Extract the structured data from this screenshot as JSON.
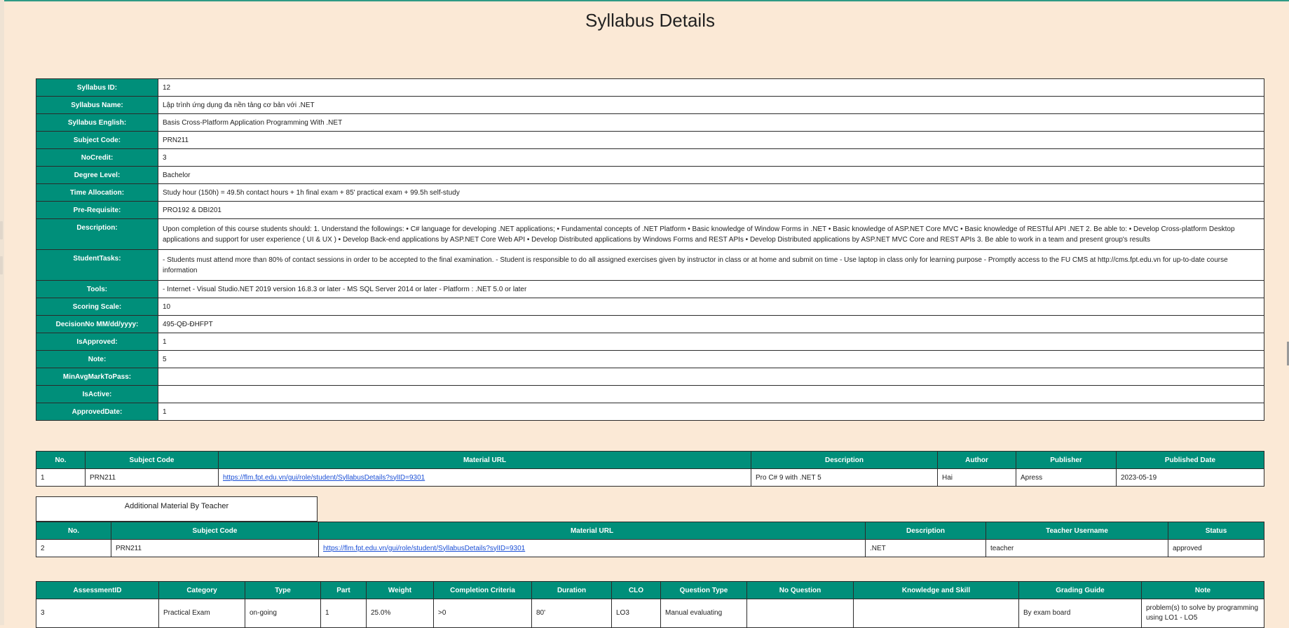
{
  "page": {
    "title": "Syllabus Details"
  },
  "details": {
    "rows": [
      {
        "label": "Syllabus ID:",
        "value": "12"
      },
      {
        "label": "Syllabus Name:",
        "value": "Lập trình ứng dụng đa nền tảng cơ bản với .NET"
      },
      {
        "label": "Syllabus English:",
        "value": "Basis Cross-Platform Application Programming With .NET"
      },
      {
        "label": "Subject Code:",
        "value": "PRN211"
      },
      {
        "label": "NoCredit:",
        "value": "3"
      },
      {
        "label": "Degree Level:",
        "value": "Bachelor"
      },
      {
        "label": "Time Allocation:",
        "value": "Study hour (150h) = 49.5h contact hours + 1h final exam + 85' practical exam + 99.5h self-study"
      },
      {
        "label": "Pre-Requisite:",
        "value": "PRO192 & DBI201"
      },
      {
        "label": "Description:",
        "value": "Upon completion of this course students should: 1. Understand the followings: • C# language for developing .NET applications; • Fundamental concepts of .NET Platform • Basic knowledge of Window Forms in .NET • Basic knowledge of ASP.NET Core MVC • Basic knowledge of RESTful API .NET 2. Be able to: • Develop Cross-platform Desktop applications and support for user experience ( UI & UX ) • Develop Back-end applications by ASP.NET Core Web API • Develop Distributed applications by Windows Forms and REST APIs • Develop Distributed applications by ASP.NET MVC Core and REST APIs 3. Be able to work in a team and present group's results"
      },
      {
        "label": "StudentTasks:",
        "value": "- Students must attend more than 80% of contact sessions in order to be accepted to the final examination. - Student is responsible to do all assigned exercises given by instructor in class or at home and submit on time - Use laptop in class only for learning purpose - Promptly access to the FU CMS at http://cms.fpt.edu.vn for up-to-date course information"
      },
      {
        "label": "Tools:",
        "value": "- Internet - Visual Studio.NET 2019 version 16.8.3 or later - MS SQL Server 2014 or later - Platform : .NET 5.0 or later"
      },
      {
        "label": "Scoring Scale:",
        "value": "10"
      },
      {
        "label": "DecisionNo MM/dd/yyyy:",
        "value": "495-QĐ-ĐHFPT"
      },
      {
        "label": "IsApproved:",
        "value": "1"
      },
      {
        "label": "Note:",
        "value": "5"
      },
      {
        "label": "MinAvgMarkToPass:",
        "value": ""
      },
      {
        "label": "IsActive:",
        "value": ""
      },
      {
        "label": "ApprovedDate:",
        "value": "1"
      }
    ]
  },
  "materials": {
    "headers": [
      "No.",
      "Subject Code",
      "Material URL",
      "Description",
      "Author",
      "Publisher",
      "Published Date"
    ],
    "rows": [
      {
        "no": "1",
        "subject_code": "PRN211",
        "url": "https://flm.fpt.edu.vn/gui/role/student/SyllabusDetails?sylID=9301",
        "description": "Pro C# 9 with .NET 5",
        "author": "Hai",
        "publisher": "Apress",
        "published_date": "2023-05-19"
      }
    ]
  },
  "teacher_materials": {
    "caption": "Additional Material By Teacher",
    "headers": [
      "No.",
      "Subject Code",
      "Material URL",
      "Description",
      "Teacher Username",
      "Status"
    ],
    "rows": [
      {
        "no": "2",
        "subject_code": "PRN211",
        "url": "https://flm.fpt.edu.vn/gui/role/student/SyllabusDetails?sylID=9301",
        "description": ".NET",
        "teacher": "teacher",
        "status": "approved"
      }
    ]
  },
  "assessments": {
    "headers": [
      "AssessmentID",
      "Category",
      "Type",
      "Part",
      "Weight",
      "Completion Criteria",
      "Duration",
      "CLO",
      "Question Type",
      "No Question",
      "Knowledge and Skill",
      "Grading Guide",
      "Note"
    ],
    "rows": [
      {
        "id": "3",
        "category": "Practical Exam",
        "type": "on-going",
        "part": "1",
        "weight": "25.0%",
        "criteria": ">0",
        "duration": "80'",
        "clo": "LO3",
        "question_type": "Manual evaluating",
        "no_question": "",
        "knowledge": "",
        "grading": "By exam board",
        "note": "problem(s) to solve by programming using LO1 - LO5"
      }
    ]
  }
}
